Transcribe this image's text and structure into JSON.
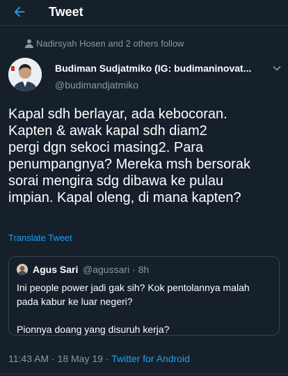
{
  "header": {
    "title": "Tweet"
  },
  "social_context": "Nadirsyah Hosen and 2 others follow",
  "author": {
    "name": "Budiman Sudjatmiko (IG: budimaninovat...",
    "handle": "@budimandjatmiko"
  },
  "tweet_lines": [
    "Kapal sdh berlayar, ada kebocoran.",
    "Kapten & awak kapal sdh diam2",
    "pergi dgn sekoci masing2. Para",
    "penumpangnya? Mereka msh bersorak",
    "sorai mengira sdg dibawa ke pulau",
    "impian. Kapal oleng, di mana kapten?"
  ],
  "translate_label": "Translate Tweet",
  "quoted": {
    "name": "Agus Sari",
    "handle": "@agussari · 8h",
    "lines": [
      "Ini people power jadi gak sih? Kok pentolannya malah",
      "pada kabur ke luar negeri?",
      "",
      "Pionnya doang yang disuruh kerja?"
    ]
  },
  "meta": {
    "timestamp": "11:43 AM · 18 May 19 · ",
    "source": "Twitter for Android"
  },
  "colors": {
    "background": "#15202b",
    "accent": "#1da1f2",
    "secondary_text": "#8899a6"
  },
  "icons": [
    "back-arrow-icon",
    "person-icon",
    "chevron-down-icon"
  ]
}
